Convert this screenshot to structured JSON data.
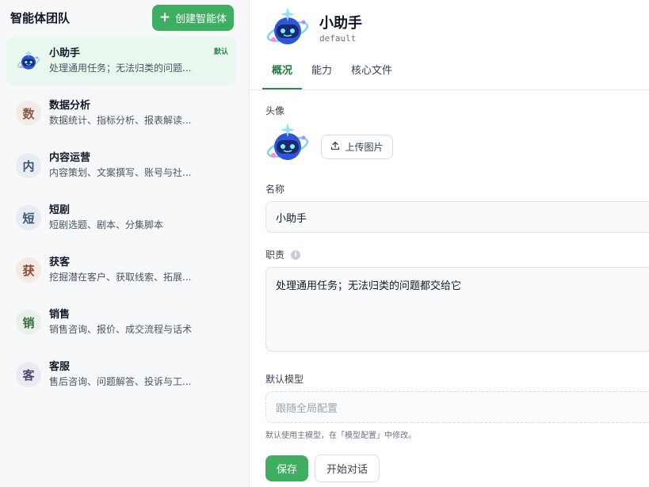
{
  "sidebar": {
    "title": "智能体团队",
    "create_button": "创建智能体",
    "agents": [
      {
        "name": "小助手",
        "desc": "处理通用任务；无法归类的问题...",
        "badge": "默认",
        "avatar": "robot-avatar"
      },
      {
        "name": "数据分析",
        "desc": "数据统计、指标分析、报表解读...",
        "initial": "数",
        "avatar_bg": "#f3ebe7",
        "avatar_fg": "#8a5a44"
      },
      {
        "name": "内容运营",
        "desc": "内容策划、文案撰写、账号与社...",
        "initial": "内",
        "avatar_bg": "#e8edf3",
        "avatar_fg": "#3b5578"
      },
      {
        "name": "短剧",
        "desc": "短剧选题、剧本、分集脚本",
        "initial": "短",
        "avatar_bg": "#e7ecf2",
        "avatar_fg": "#3f5670"
      },
      {
        "name": "获客",
        "desc": "挖掘潜在客户、获取线索、拓展...",
        "initial": "获",
        "avatar_bg": "#f5e9e4",
        "avatar_fg": "#8b4a2e"
      },
      {
        "name": "销售",
        "desc": "销售咨询、报价、成交流程与话术",
        "initial": "销",
        "avatar_bg": "#e8f1e9",
        "avatar_fg": "#3a6b44"
      },
      {
        "name": "客服",
        "desc": "售后咨询、问题解答、投诉与工...",
        "initial": "客",
        "avatar_bg": "#ece9f2",
        "avatar_fg": "#4e4668"
      }
    ]
  },
  "header": {
    "name": "小助手",
    "id": "default",
    "tabs": [
      "概况",
      "能力",
      "核心文件"
    ],
    "active_tab": "概况"
  },
  "form": {
    "avatar_label": "头像",
    "upload_button": "上传图片",
    "name_label": "名称",
    "name_value": "小助手",
    "duty_label": "职责",
    "duty_value": "处理通用任务；无法归类的问题都交给它",
    "model_label": "默认模型",
    "model_placeholder": "跟随全局配置",
    "model_hint": "默认使用主模型，在「模型配置」中修改。",
    "save_button": "保存",
    "chat_button": "开始对话"
  },
  "colors": {
    "accent": "#3fae62",
    "active_bg": "#e9f7ee"
  }
}
